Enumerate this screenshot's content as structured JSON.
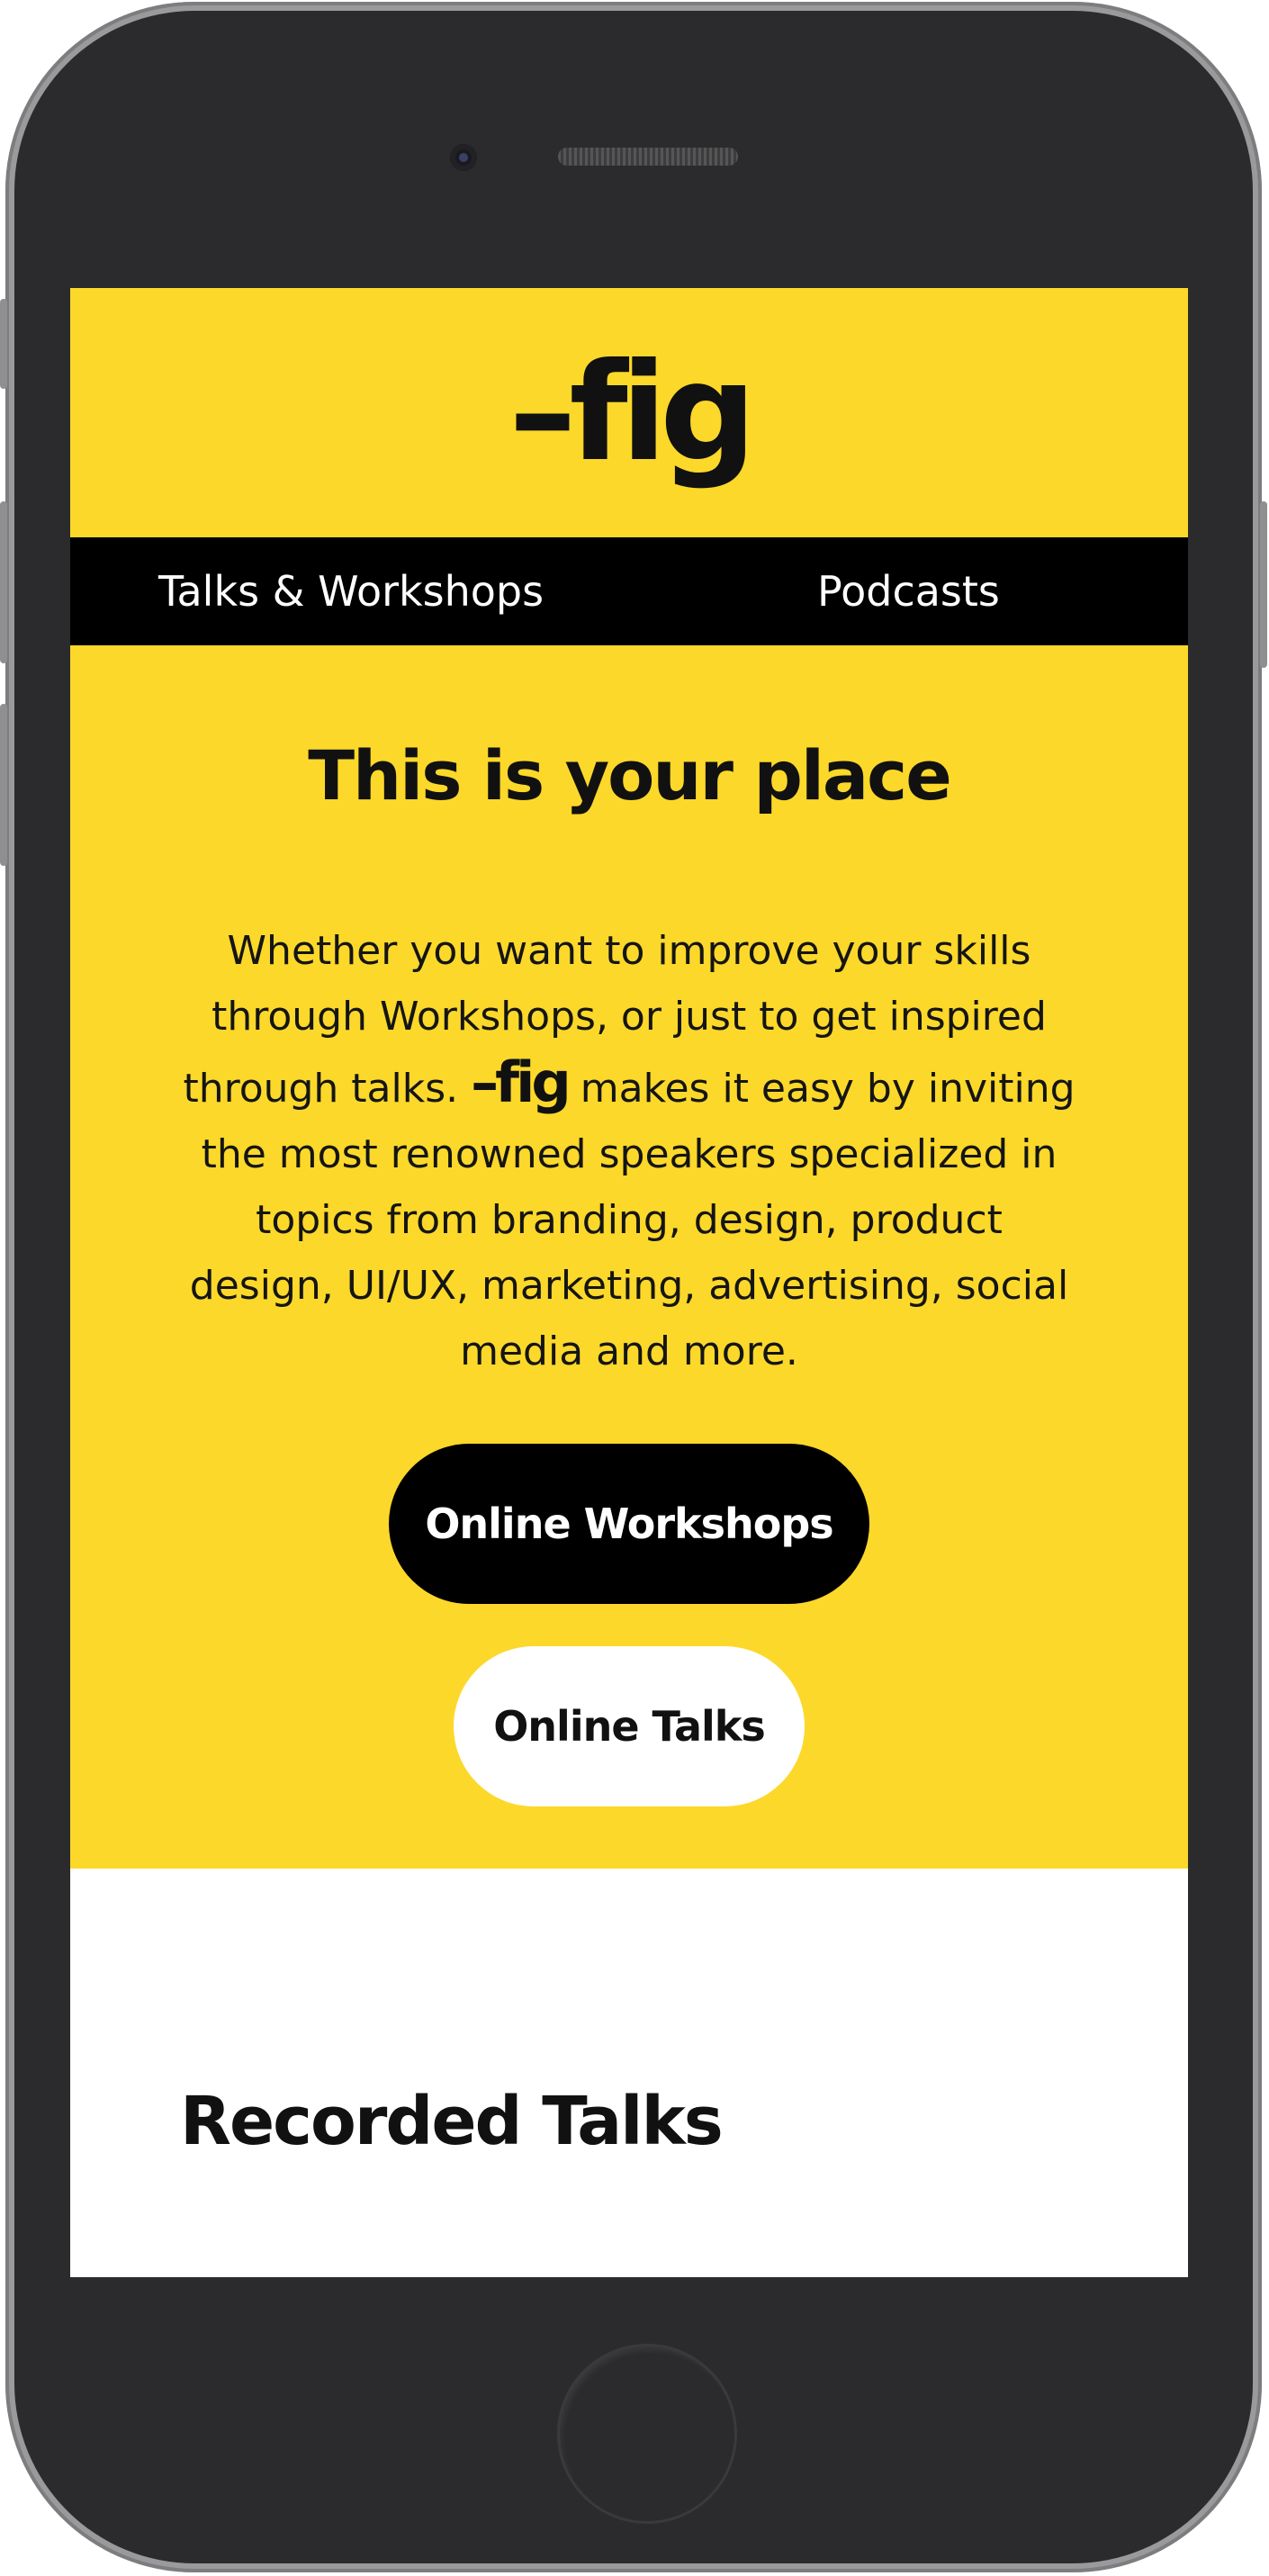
{
  "header": {
    "logo": "–fig"
  },
  "nav": {
    "items": [
      {
        "label": "Talks & Workshops"
      },
      {
        "label": "Podcasts"
      }
    ]
  },
  "hero": {
    "title": "This is your place",
    "text_before": "Whether you want to improve your skills through Workshops, or just to get inspired through talks.",
    "inline_logo": "–fig",
    "text_after": "makes it easy by inviting the most renowned speakers specialized in topics from branding, design, product design, UI/UX, marketing, advertising, social media and more.",
    "primary_button": "Online Workshops",
    "secondary_button": "Online Talks"
  },
  "recorded": {
    "title": "Recorded Talks"
  },
  "colors": {
    "brand_yellow": "#fcd82a",
    "nav_black": "#000000",
    "phone_frame": "#2b2b2d"
  }
}
